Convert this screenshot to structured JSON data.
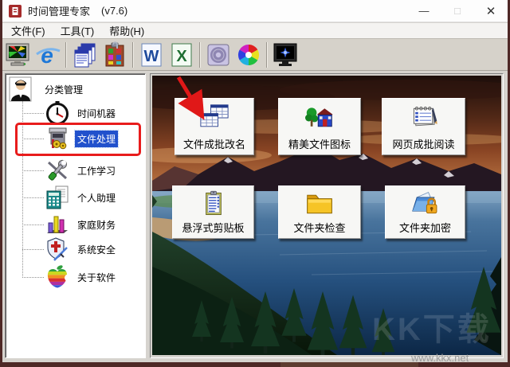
{
  "window": {
    "title": "时间管理专家",
    "version": "(v7.6)",
    "controls": {
      "minimize": "—",
      "maximize": "□",
      "close": "✕"
    }
  },
  "menu": {
    "items": [
      {
        "label": "文件(F)"
      },
      {
        "label": "工具(T)"
      },
      {
        "label": "帮助(H)"
      }
    ]
  },
  "toolbar": {
    "icons": [
      "desktop-display",
      "internet-explorer",
      "documents-stack",
      "icon-clipboard",
      "word",
      "excel",
      "cd-rom",
      "color-disc",
      "screen-saver"
    ]
  },
  "sidebar": {
    "root": "分类管理",
    "selected": "文件处理",
    "items": [
      {
        "label": "时间机器"
      },
      {
        "label": "文件处理"
      },
      {
        "label": "工作学习"
      },
      {
        "label": "个人助理"
      },
      {
        "label": "家庭财务"
      },
      {
        "label": "系统安全"
      },
      {
        "label": "关于软件"
      }
    ]
  },
  "main": {
    "buttons": [
      {
        "label": "文件成批改名"
      },
      {
        "label": "精美文件图标"
      },
      {
        "label": "网页成批阅读"
      },
      {
        "label": "悬浮式剪贴板"
      },
      {
        "label": "文件夹检查"
      },
      {
        "label": "文件夹加密"
      }
    ]
  },
  "annotations": {
    "highlighted_item": "文件处理",
    "arrow_points_to": "文件成批改名"
  },
  "watermark": {
    "logo": "KK下载",
    "site": "www.kkx.net"
  },
  "colors": {
    "selection": "#2151cc",
    "annotation": "#e81c1c",
    "toolbar_bg": "#d6d2ca",
    "border": "#4e2826"
  }
}
